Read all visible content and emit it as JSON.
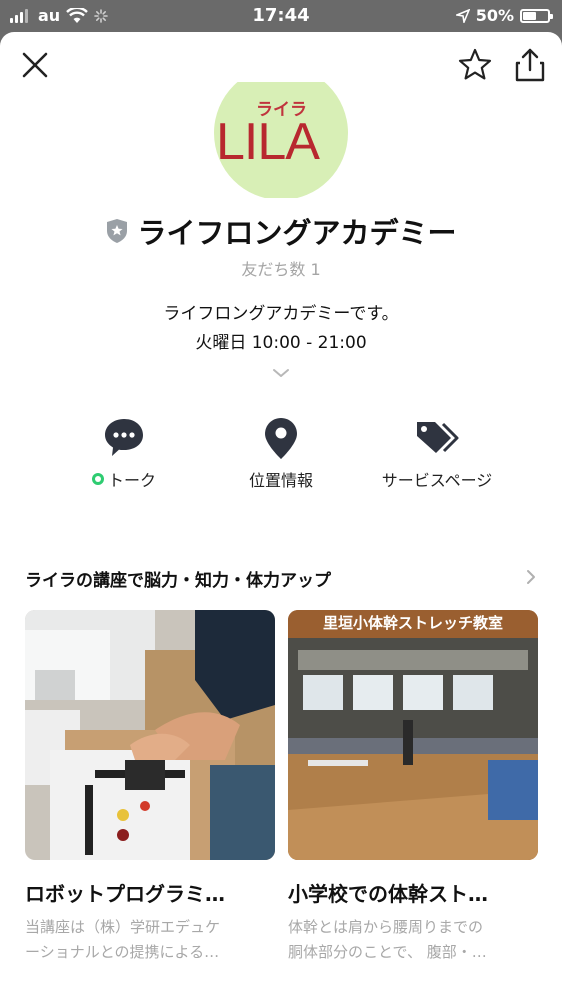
{
  "status_bar": {
    "carrier": "au",
    "time": "17:44",
    "battery": "50%",
    "battery_level": 0.5
  },
  "profile": {
    "logo_kana": "ライラ",
    "logo_text": "LILA",
    "name": "ライフロングアカデミー",
    "friends": "友だち数 1",
    "description_line1": "ライフロングアカデミーです。",
    "description_line2": "火曜日 10:00 - 21:00"
  },
  "actions": [
    {
      "label": "トーク",
      "icon": "chat-bubble-icon"
    },
    {
      "label": "位置情報",
      "icon": "map-pin-icon"
    },
    {
      "label": "サービスページ",
      "icon": "tag-icon"
    }
  ],
  "section": {
    "title": "ライラの講座で脳力・知力・体力アップ"
  },
  "cards": [
    {
      "title": "ロボットプログラミ…",
      "desc_line1": "当講座は（株）学研エデュケ",
      "desc_line2": "ーショナルとの提携による…"
    },
    {
      "title": "小学校での体幹スト…",
      "desc_line1": "体幹とは肩から腰周りまでの",
      "desc_line2": "胴体部分のことで、 腹部・…",
      "image_caption": "里垣小体幹ストレッチ教室"
    }
  ]
}
